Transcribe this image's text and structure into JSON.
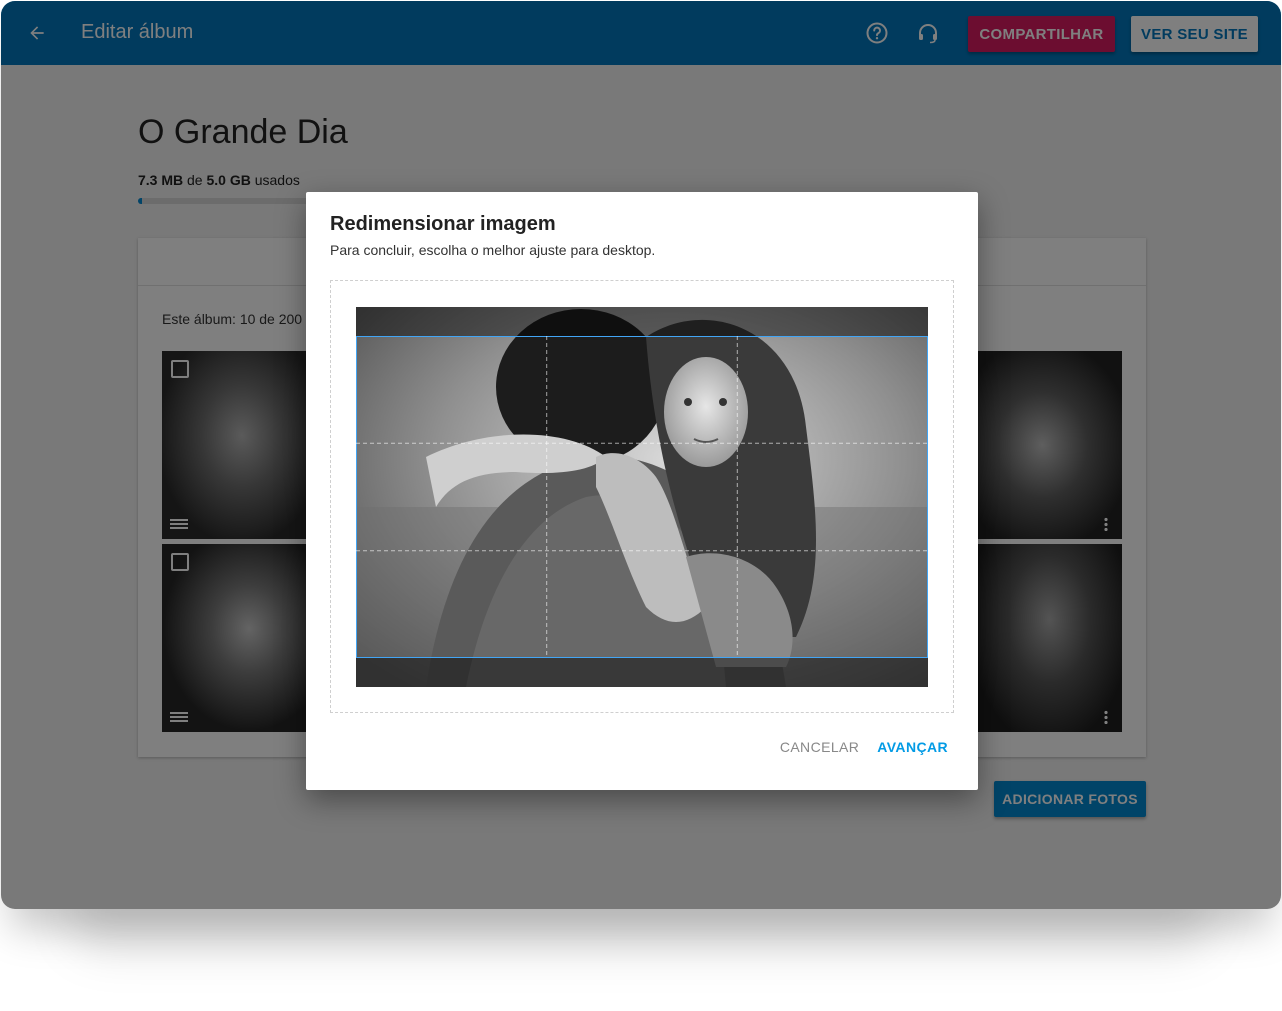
{
  "header": {
    "title": "Editar álbum",
    "back_icon": "arrow-left-icon",
    "help_icon": "help-circle-icon",
    "support_icon": "headset-icon",
    "share_label": "COMPARTILHAR",
    "site_label": "VER SEU SITE"
  },
  "album": {
    "title": "O Grande Dia",
    "storage": {
      "used": "7.3 MB",
      "of": "de",
      "total": "5.0 GB",
      "suffix": "usados",
      "fraction": 0.0015
    },
    "count_text": "Este álbum: 10 de 200",
    "add_photos_label": "ADICIONAR FOTOS"
  },
  "dialog": {
    "title": "Redimensionar imagem",
    "subtitle": "Para concluir, escolha o melhor ajuste para desktop.",
    "cancel_label": "CANCELAR",
    "next_label": "AVANÇAR"
  },
  "colors": {
    "primary": "#0277bd",
    "accent": "#d81b60",
    "button_blue": "#0288d1",
    "crop_border": "#42a5f5"
  }
}
